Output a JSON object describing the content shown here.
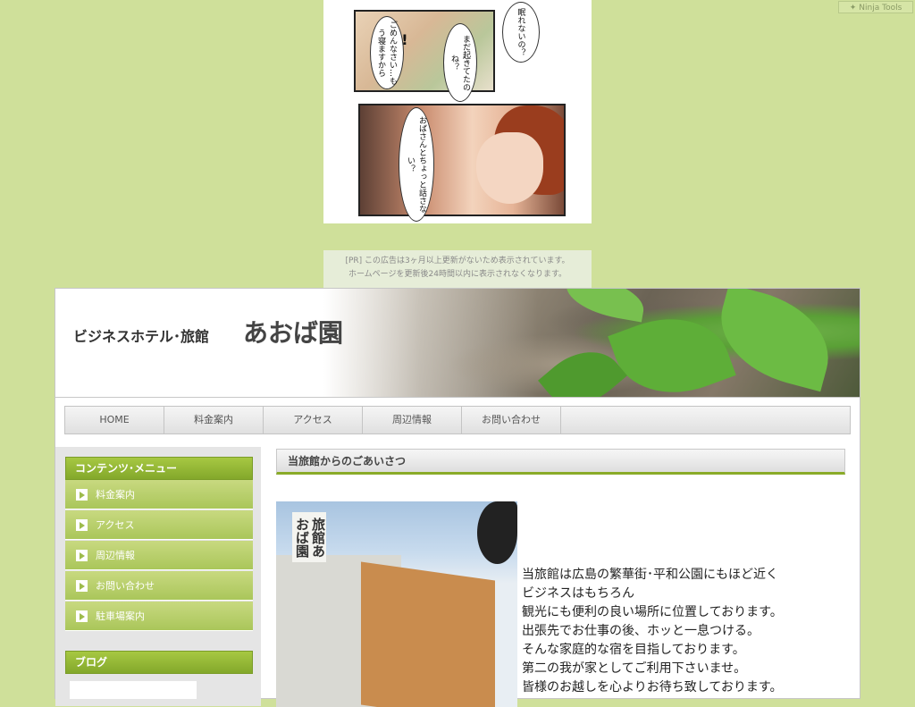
{
  "ninja_tools": {
    "label": "Ninja Tools"
  },
  "ad": {
    "bubbles": [
      "眠れないの？",
      "まだ起きてたのね？",
      "ごめんなさい…もう寝ますから",
      "おばさんとちょっと話さない？"
    ],
    "exclaim": "!!",
    "note_line1": "[PR] この広告は3ヶ月以上更新がないため表示されています。",
    "note_line2": "ホームページを更新後24時間以内に表示されなくなります。"
  },
  "header": {
    "subtitle": "ビジネスホテル･旅館",
    "title": "あおば園"
  },
  "nav": {
    "items": [
      "HOME",
      "料金案内",
      "アクセス",
      "周辺情報",
      "お問い合わせ"
    ]
  },
  "sidebar": {
    "menu_title": "コンテンツ･メニュー",
    "items": [
      "料金案内",
      "アクセス",
      "周辺情報",
      "お問い合わせ",
      "駐車場案内"
    ],
    "blog_title": "ブログ"
  },
  "main": {
    "heading": "当旅館からのごあいさつ",
    "photo_sign": "旅館あおば園",
    "intro_lines": [
      "当旅館は広島の繁華街･平和公園にもほど近く",
      "ビジネスはもちろん",
      "観光にも便利の良い場所に位置しております。",
      "出張先でお仕事の後、ホッと一息つける。",
      "そんな家庭的な宿を目指しております。",
      "第二の我が家としてご利用下さいませ。",
      "皆様のお越しを心よりお待ち致しております。"
    ]
  },
  "colors": {
    "page_bg": "#cfe09a",
    "accent_green": "#8aab28",
    "menu_green": "#a7c842"
  }
}
